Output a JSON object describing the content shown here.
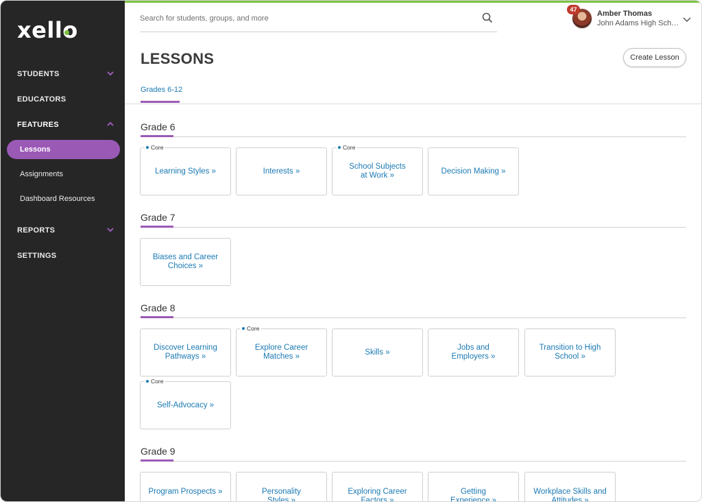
{
  "app": {
    "logo": "xello"
  },
  "colors": {
    "accent_purple": "#9b59b6",
    "link_blue": "#1b7ab4",
    "sidebar_bg": "#262626",
    "brand_green": "#7cc242",
    "badge_red": "#c0392b"
  },
  "sidebar": {
    "nav": [
      {
        "label": "STUDENTS",
        "chevron": "chevron-down-icon"
      },
      {
        "label": "EDUCATORS"
      },
      {
        "label": "FEATURES",
        "chevron": "chevron-up-icon"
      },
      {
        "label": "REPORTS",
        "chevron": "chevron-down-icon"
      },
      {
        "label": "SETTINGS"
      }
    ],
    "features_sub": [
      {
        "label": "Lessons",
        "active": true
      },
      {
        "label": "Assignments"
      },
      {
        "label": "Dashboard Resources"
      }
    ]
  },
  "header": {
    "search_placeholder": "Search for students, groups, and more",
    "notification_count": "47",
    "user_name": "Amber Thomas",
    "user_school": "John Adams High School"
  },
  "page": {
    "title": "LESSONS",
    "create_button": "Create Lesson",
    "tabs": [
      {
        "label": "Grades 6-12",
        "active": true
      }
    ],
    "core_label": "Core"
  },
  "grades": [
    {
      "title": "Grade 6",
      "lessons": [
        {
          "label": "Learning Styles »",
          "core": true
        },
        {
          "label": "Interests »",
          "core": false
        },
        {
          "label": "School Subjects at Work »",
          "core": true
        },
        {
          "label": "Decision Making »",
          "core": false
        }
      ]
    },
    {
      "title": "Grade 7",
      "lessons": [
        {
          "label": "Biases and Career Choices »",
          "core": false
        }
      ]
    },
    {
      "title": "Grade 8",
      "lessons": [
        {
          "label": "Discover Learning Pathways »",
          "core": false
        },
        {
          "label": "Explore Career Matches »",
          "core": true
        },
        {
          "label": "Skills »",
          "core": false
        },
        {
          "label": "Jobs and Employers »",
          "core": false
        },
        {
          "label": "Transition to High School »",
          "core": false
        },
        {
          "label": "Self-Advocacy »",
          "core": true
        }
      ]
    },
    {
      "title": "Grade 9",
      "lessons": [
        {
          "label": "Program Prospects »",
          "core": false
        },
        {
          "label": "Personality Styles »",
          "core": false
        },
        {
          "label": "Exploring Career Factors »",
          "core": false
        },
        {
          "label": "Getting Experience »",
          "core": false
        },
        {
          "label": "Workplace Skills and Attitudes »",
          "core": false
        }
      ]
    }
  ]
}
